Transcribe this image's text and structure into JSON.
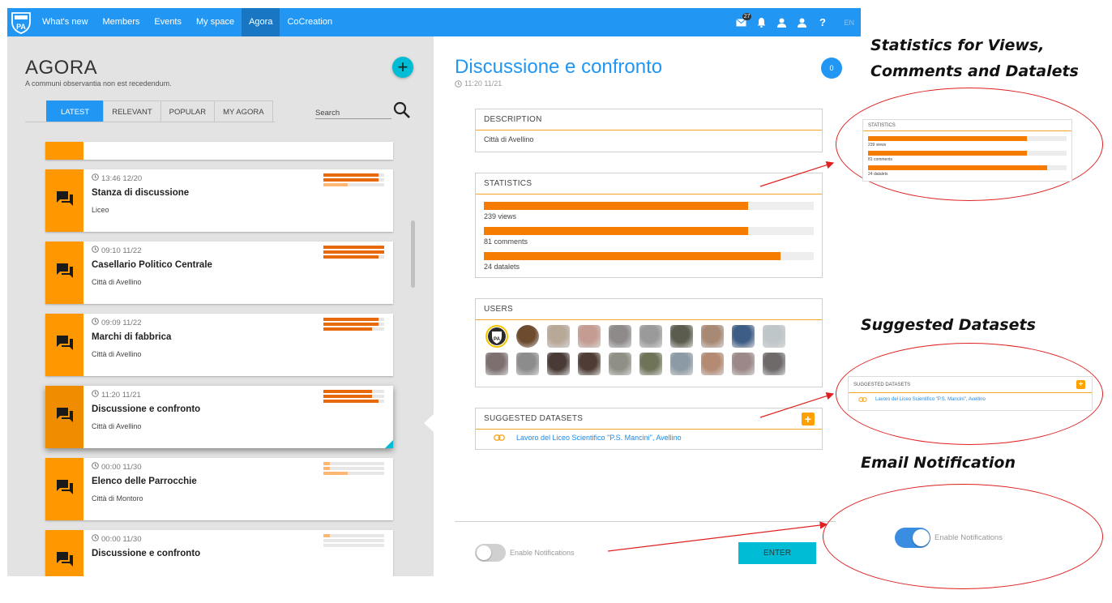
{
  "topbar": {
    "logo_text": "ROUTE-TO PA",
    "nav": [
      "What's new",
      "Members",
      "Events",
      "My space",
      "Agora",
      "CoCreation"
    ],
    "active_nav": "Agora",
    "mail_badge": "27",
    "icons": [
      "mail-icon",
      "bell-icon",
      "user-icon",
      "user-icon",
      "help-icon"
    ],
    "help_label": "?",
    "lang": "EN"
  },
  "agora": {
    "title": "AGORA",
    "subtitle": "A communi observantia non est recedendum.",
    "add_label": "+",
    "tabs": [
      "LATEST",
      "RELEVANT",
      "POPULAR",
      "MY AGORA"
    ],
    "active_tab": "LATEST",
    "search_label": "Search"
  },
  "feed": [
    {
      "time": "13:46 12/20",
      "title": "Stanza di discussione",
      "subtitle": "Liceo",
      "bars": [
        0.9,
        0.9,
        0.4
      ],
      "light": [
        false,
        false,
        true
      ]
    },
    {
      "time": "09:10 11/22",
      "title": "Casellario Politico Centrale",
      "subtitle": "Città di Avellino",
      "bars": [
        1.0,
        1.0,
        0.9
      ],
      "light": [
        false,
        false,
        false
      ]
    },
    {
      "time": "09:09 11/22",
      "title": "Marchi di fabbrica",
      "subtitle": "Città di Avellino",
      "bars": [
        0.9,
        0.9,
        0.8
      ],
      "light": [
        false,
        false,
        false
      ]
    },
    {
      "time": "11:20 11/21",
      "title": "Discussione e confronto",
      "subtitle": "Città di Avellino",
      "bars": [
        0.8,
        0.8,
        0.9
      ],
      "light": [
        false,
        false,
        false
      ]
    },
    {
      "time": "00:00 11/30",
      "title": "Elenco delle Parrocchie",
      "subtitle": "Città di Montoro",
      "bars": [
        0.1,
        0.1,
        0.4
      ],
      "light": [
        true,
        true,
        true
      ]
    },
    {
      "time": "00:00 11/30",
      "title": "Discussione e confronto",
      "subtitle": "",
      "bars": [
        0.1,
        0.0,
        0.0
      ],
      "light": [
        true,
        true,
        true
      ]
    }
  ],
  "detail": {
    "title": "Discussione e confronto",
    "time": "11:20 11/21",
    "count": "0",
    "description_header": "DESCRIPTION",
    "description": "Città di Avellino",
    "statistics_header": "STATISTICS",
    "stats": [
      {
        "label": "239 views",
        "fraction": 0.8
      },
      {
        "label": "81 comments",
        "fraction": 0.8
      },
      {
        "label": "24 datalets",
        "fraction": 0.9
      }
    ],
    "users_header": "USERS",
    "users_count": 20,
    "user_colors": [
      "#f3c500",
      "#6d4b2f",
      "#b8a898",
      "#c49c92",
      "#8e8a8a",
      "#9a9a9a",
      "#5c5c4e",
      "#a88974",
      "#3d5d86",
      "#bfc6c9",
      "#7d6f6f",
      "#8c8c8c",
      "#4a3a36",
      "#4f3d35",
      "#8f8f85",
      "#6f7458",
      "#8b9aa4",
      "#b58a73",
      "#9c8888",
      "#6e6a6a"
    ],
    "datasets_header": "SUGGESTED DATASETS",
    "dataset_link": "Lavoro del Liceo Scientifico \"P.S. Mancini\", Avellino",
    "notifications_label": "Enable Notifications",
    "notifications_on": false,
    "enter_label": "ENTER"
  },
  "annotations": {
    "stats_caption_1": "Statistics for Views,",
    "stats_caption_2": "Comments and Datalets",
    "datasets_caption": "Suggested Datasets",
    "email_caption": "Email Notification",
    "zoom_stats_header": "STATISTICS",
    "zoom_datasets_header": "SUGGESTED DATASETS",
    "zoom_notifications_label": "Enable Notifications",
    "zoom_notifications_on": true
  },
  "colors": {
    "primary": "#2196f3",
    "accent_orange": "#ff9800",
    "bar_orange": "#f57c00",
    "cyan": "#00bcd4",
    "annotation_red": "#e02020"
  }
}
